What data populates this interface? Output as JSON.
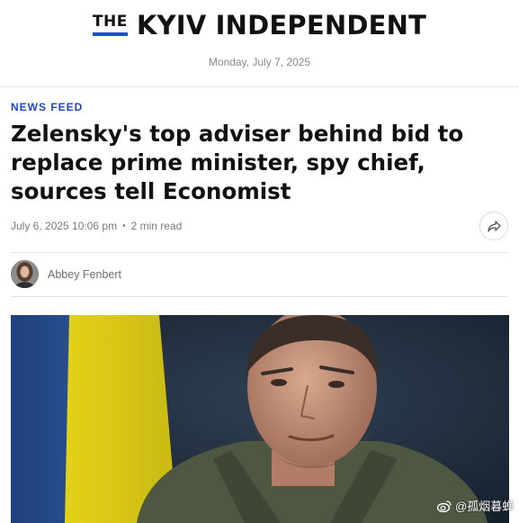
{
  "site": {
    "logo_the": "THE",
    "logo_name": "KYIV INDEPENDENT",
    "date": "Monday, July 7, 2025",
    "accent_color": "#1a4fd6"
  },
  "article": {
    "category": "NEWS FEED",
    "headline": "Zelensky's top adviser behind bid to replace prime minister, spy chief, sources tell Economist",
    "published": "July 6, 2025 10:06 pm",
    "separator": "•",
    "read_time": "2 min read",
    "author": "Abbey Fenbert",
    "share_icon": "share-arrow-icon"
  },
  "watermark": {
    "icon": "weibo-icon",
    "text": "@孤烟暮蝉"
  }
}
